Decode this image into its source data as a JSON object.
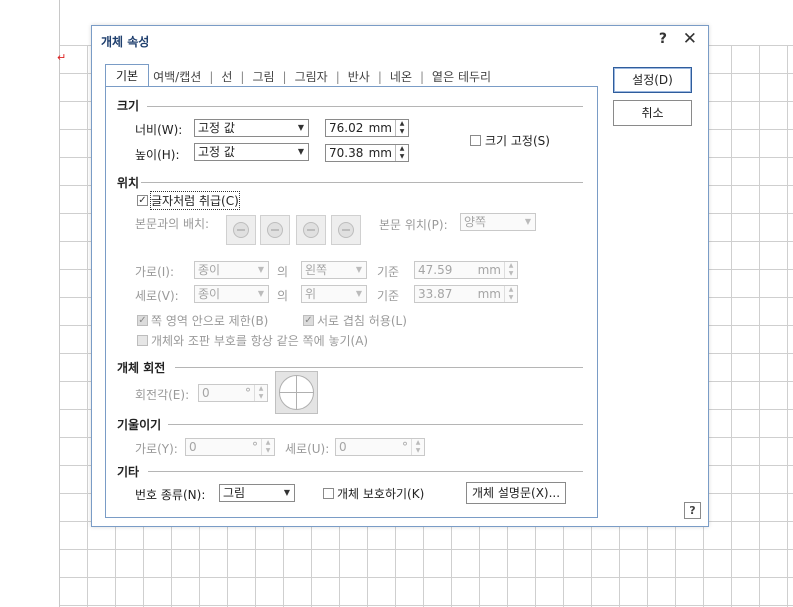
{
  "doc": {
    "cursor_glyph": "↵"
  },
  "dialog": {
    "title": "개체 속성",
    "help": "?",
    "close": "✕",
    "tabs": [
      "기본",
      "여백/캡션",
      "선",
      "그림",
      "그림자",
      "반사",
      "네온",
      "옅은 테두리"
    ],
    "tab_sep": "|",
    "size": {
      "section": "크기",
      "width_label": "너비(W):",
      "width_mode": "고정 값",
      "width_value": "76.02",
      "height_label": "높이(H):",
      "height_mode": "고정 값",
      "height_value": "70.38",
      "unit": "mm",
      "lock_label": "크기 고정(S)"
    },
    "position": {
      "section": "위치",
      "treat_as_char": "글자처럼 취급(C)",
      "placement_label": "본문과의 배치:",
      "text_pos_label": "본문 위치(P):",
      "text_pos_value": "양쪽",
      "horiz_label": "가로(I):",
      "horiz_ref": "종이",
      "horiz_of": "의",
      "horiz_align": "왼쪽",
      "horiz_base": "기준",
      "horiz_value": "47.59",
      "vert_label": "세로(V):",
      "vert_ref": "종이",
      "vert_of": "의",
      "vert_align": "위",
      "vert_base": "기준",
      "vert_value": "33.87",
      "unit": "mm",
      "limit_label": "쪽 영역 안으로 제한(B)",
      "overlap_label": "서로 겹침 허용(L)",
      "same_page_label": "개체와 조판 부호를 항상 같은 쪽에 놓기(A)"
    },
    "rotation": {
      "section": "개체 회전",
      "angle_label": "회전각(E):",
      "angle_value": "0",
      "deg": "°"
    },
    "skew": {
      "section": "기울이기",
      "horiz_label": "가로(Y):",
      "horiz_value": "0",
      "vert_label": "세로(U):",
      "vert_value": "0",
      "deg": "°"
    },
    "etc": {
      "section": "기타",
      "numbering_label": "번호 종류(N):",
      "numbering_value": "그림",
      "protect_label": "개체 보호하기(K)",
      "desc_button": "개체 설명문(X)..."
    },
    "buttons": {
      "ok": "설정(D)",
      "cancel": "취소",
      "help_box": "?"
    }
  }
}
